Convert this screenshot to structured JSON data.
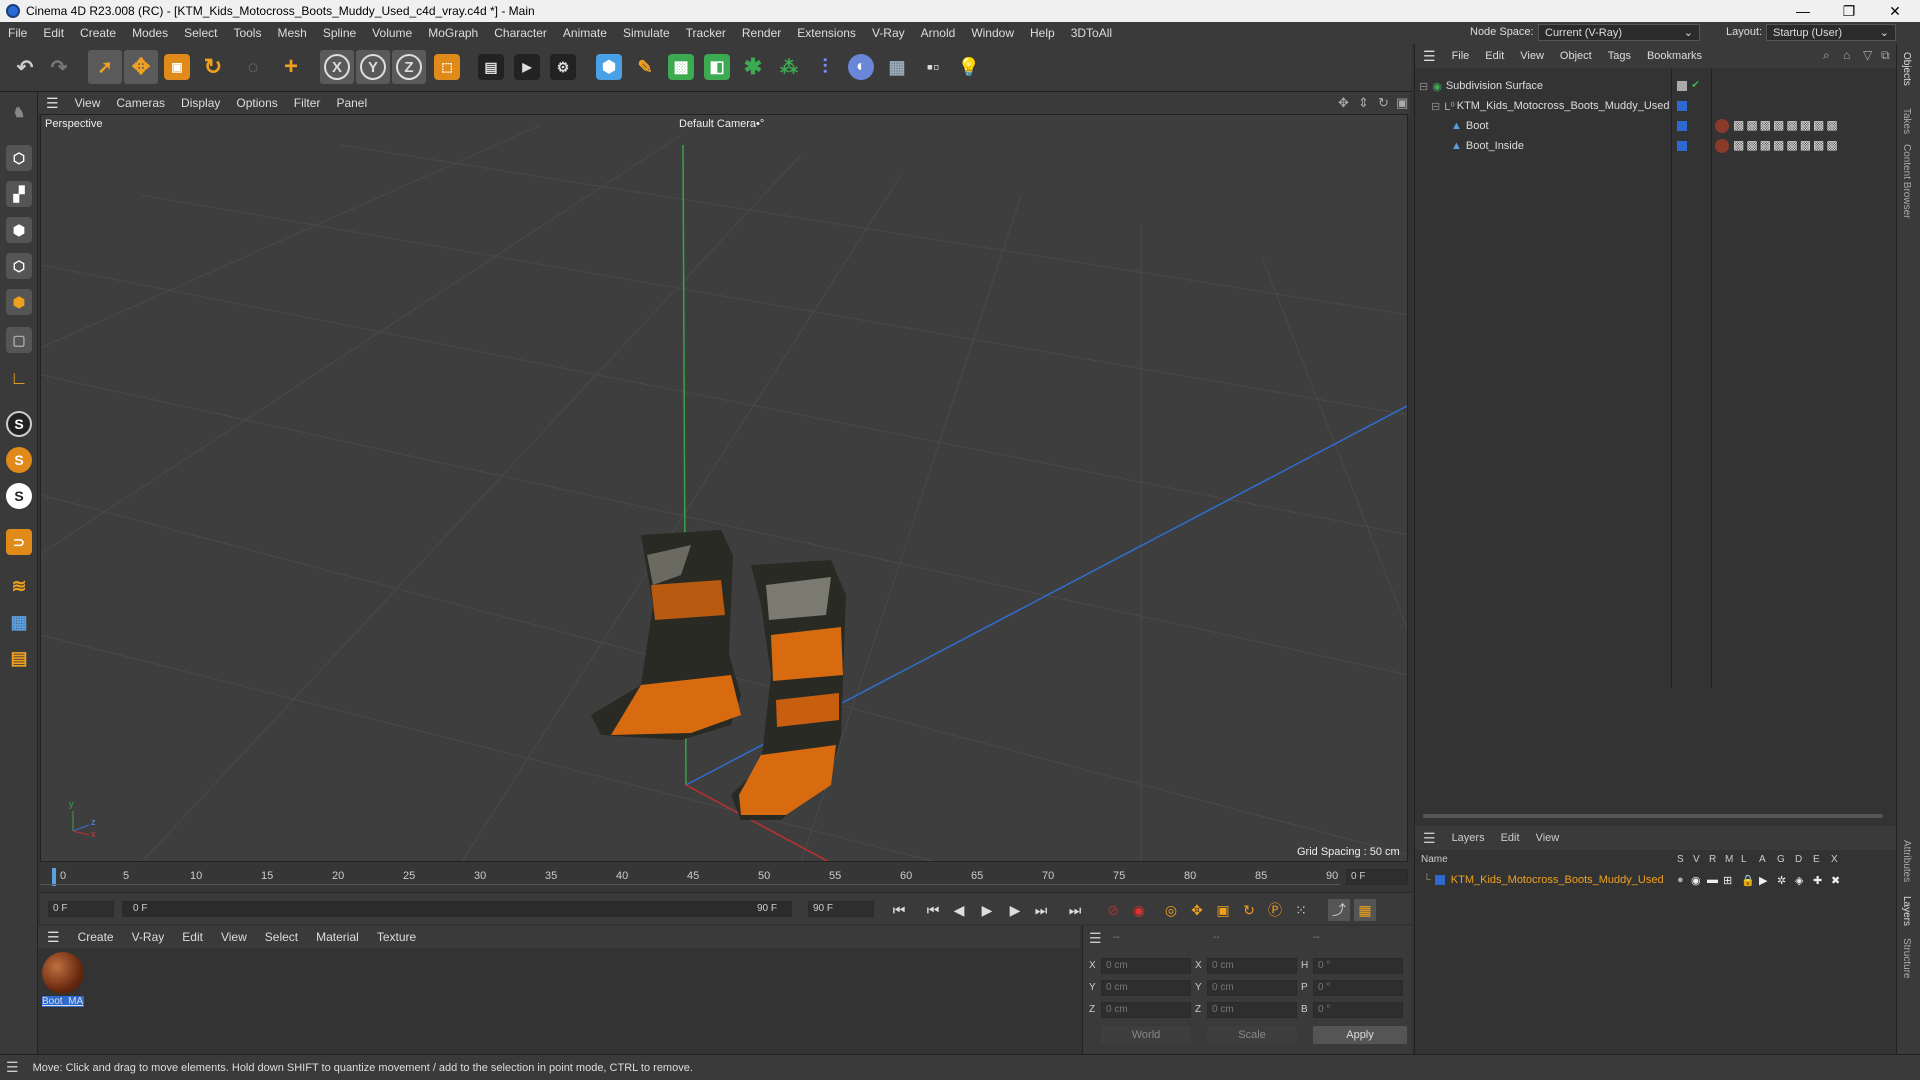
{
  "titlebar": {
    "title": "Cinema 4D R23.008 (RC) - [KTM_Kids_Motocross_Boots_Muddy_Used_c4d_vray.c4d *] - Main",
    "min": "—",
    "max": "❐",
    "close": "✕"
  },
  "menubar": {
    "items": [
      "File",
      "Edit",
      "Create",
      "Modes",
      "Select",
      "Tools",
      "Mesh",
      "Spline",
      "Volume",
      "MoGraph",
      "Character",
      "Animate",
      "Simulate",
      "Tracker",
      "Render",
      "Extensions",
      "V-Ray",
      "Arnold",
      "Window",
      "Help",
      "3DToAll"
    ],
    "node_space_label": "Node Space:",
    "node_space_value": "Current (V-Ray)",
    "layout_label": "Layout:",
    "layout_value": "Startup (User)"
  },
  "viewport": {
    "menu": [
      "View",
      "Cameras",
      "Display",
      "Options",
      "Filter",
      "Panel"
    ],
    "label": "Perspective",
    "camera": "Default Camera",
    "camera_suffix": "•°",
    "grid_spacing": "Grid Spacing : 50 cm",
    "axis_y": "y",
    "axis_z": "z",
    "axis_x": "x"
  },
  "timeline": {
    "ticks": [
      "0",
      "5",
      "10",
      "15",
      "20",
      "25",
      "30",
      "35",
      "40",
      "45",
      "50",
      "55",
      "60",
      "65",
      "70",
      "75",
      "80",
      "85",
      "90"
    ],
    "current_frame": "0 F"
  },
  "transport": {
    "start_field": "0 F",
    "range_start": "0 F",
    "range_end": "90 F",
    "end_field": "90 F"
  },
  "materials": {
    "menu": [
      "Create",
      "V-Ray",
      "Edit",
      "View",
      "Select",
      "Material",
      "Texture"
    ],
    "items": [
      {
        "name": "Boot_MA"
      }
    ]
  },
  "attributes": {
    "header": [
      "--",
      "--",
      "--"
    ],
    "rows": [
      {
        "l1": "X",
        "v1": "0 cm",
        "l2": "X",
        "v2": "0 cm",
        "l3": "H",
        "v3": "0 °"
      },
      {
        "l1": "Y",
        "v1": "0 cm",
        "l2": "Y",
        "v2": "0 cm",
        "l3": "P",
        "v3": "0 °"
      },
      {
        "l1": "Z",
        "v1": "0 cm",
        "l2": "Z",
        "v2": "0 cm",
        "l3": "B",
        "v3": "0 °"
      }
    ],
    "coord_dropdown": "World",
    "mode_dropdown": "Scale",
    "apply": "Apply"
  },
  "objects": {
    "menu": [
      "File",
      "Edit",
      "View",
      "Object",
      "Tags",
      "Bookmarks"
    ],
    "items": [
      {
        "name": "Subdivision Surface",
        "indent": 0,
        "color": "#e6e6e6"
      },
      {
        "name": "KTM_Kids_Motocross_Boots_Muddy_Used",
        "indent": 1,
        "color": "#e6e6e6"
      },
      {
        "name": "Boot",
        "indent": 2,
        "color": "#e6e6e6"
      },
      {
        "name": "Boot_Inside",
        "indent": 2,
        "color": "#e6e6e6"
      }
    ]
  },
  "layers": {
    "menu": [
      "Layers",
      "Edit",
      "View"
    ],
    "columns": [
      "Name",
      "S",
      "V",
      "R",
      "M",
      "L",
      "A",
      "G",
      "D",
      "E",
      "X"
    ],
    "items": [
      {
        "name": "KTM_Kids_Motocross_Boots_Muddy_Used",
        "color": "#f0a020"
      }
    ]
  },
  "sidetabs": [
    "Objects",
    "Takes",
    "Content Browser",
    "Attributes",
    "Layers",
    "Structure"
  ],
  "status": "Move: Click and drag to move elements. Hold down SHIFT to quantize movement / add to the selection in point mode, CTRL to remove.",
  "colors": {
    "accent": "#f0a020",
    "selection_blue": "#2d6ad0",
    "axis_green": "#3aa34a",
    "axis_blue": "#2f6fcf",
    "axis_red": "#c03030"
  }
}
